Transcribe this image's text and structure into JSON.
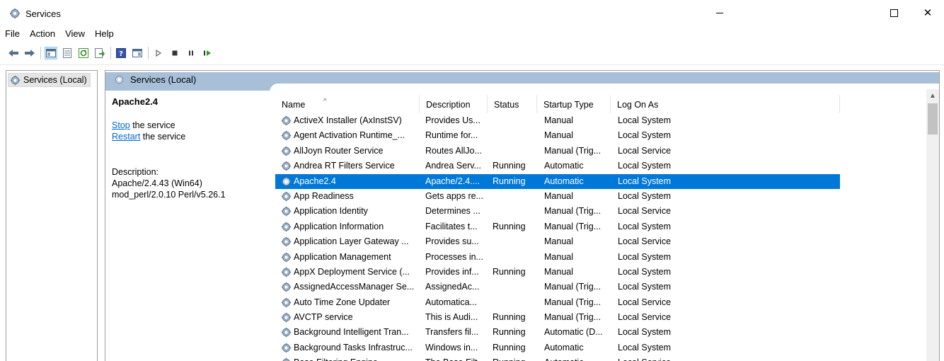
{
  "window": {
    "title": "Services",
    "icon": "services-gear-icon",
    "controls": [
      "minimize-icon",
      "maximize-icon",
      "close-icon"
    ],
    "close_glyph": "✕"
  },
  "menu": {
    "items": [
      "File",
      "Action",
      "View",
      "Help"
    ]
  },
  "toolbar": {
    "icons": [
      "back-arrow-icon",
      "forward-arrow-icon",
      "console-tree-icon",
      "properties-icon",
      "refresh-icon",
      "export-list-icon",
      "help-icon",
      "show-action-pane-icon",
      "start-service-icon",
      "stop-service-icon",
      "pause-service-icon",
      "restart-service-icon"
    ]
  },
  "tree": {
    "root_label": "Services (Local)"
  },
  "pane": {
    "title": "Services (Local)"
  },
  "details": {
    "service_name": "Apache2.4",
    "stop_link": "Stop",
    "stop_suffix": " the service",
    "restart_link": "Restart",
    "restart_suffix": " the service",
    "description_label": "Description:",
    "description_text": "Apache/2.4.43 (Win64) mod_perl/2.0.10 Perl/v5.26.1"
  },
  "list": {
    "sort_indicator": "^",
    "columns": [
      "Name",
      "Description",
      "Status",
      "Startup Type",
      "Log On As"
    ],
    "rows": [
      {
        "name": "ActiveX Installer (AxInstSV)",
        "description": "Provides Us...",
        "status": "",
        "startup": "Manual",
        "logon": "Local System"
      },
      {
        "name": "Agent Activation Runtime_...",
        "description": "Runtime for...",
        "status": "",
        "startup": "Manual",
        "logon": "Local System"
      },
      {
        "name": "AllJoyn Router Service",
        "description": "Routes AllJo...",
        "status": "",
        "startup": "Manual (Trig...",
        "logon": "Local Service"
      },
      {
        "name": "Andrea RT Filters Service",
        "description": "Andrea Serv...",
        "status": "Running",
        "startup": "Automatic",
        "logon": "Local System"
      },
      {
        "name": "Apache2.4",
        "description": "Apache/2.4....",
        "status": "Running",
        "startup": "Automatic",
        "logon": "Local System",
        "selected": true
      },
      {
        "name": "App Readiness",
        "description": "Gets apps re...",
        "status": "",
        "startup": "Manual",
        "logon": "Local System"
      },
      {
        "name": "Application Identity",
        "description": "Determines ...",
        "status": "",
        "startup": "Manual (Trig...",
        "logon": "Local Service"
      },
      {
        "name": "Application Information",
        "description": "Facilitates t...",
        "status": "Running",
        "startup": "Manual (Trig...",
        "logon": "Local System"
      },
      {
        "name": "Application Layer Gateway ...",
        "description": "Provides su...",
        "status": "",
        "startup": "Manual",
        "logon": "Local Service"
      },
      {
        "name": "Application Management",
        "description": "Processes in...",
        "status": "",
        "startup": "Manual",
        "logon": "Local System"
      },
      {
        "name": "AppX Deployment Service (...",
        "description": "Provides inf...",
        "status": "Running",
        "startup": "Manual",
        "logon": "Local System"
      },
      {
        "name": "AssignedAccessManager Se...",
        "description": "AssignedAc...",
        "status": "",
        "startup": "Manual (Trig...",
        "logon": "Local System"
      },
      {
        "name": "Auto Time Zone Updater",
        "description": "Automatica...",
        "status": "",
        "startup": "Manual (Trig...",
        "logon": "Local Service"
      },
      {
        "name": "AVCTP service",
        "description": "This is Audi...",
        "status": "Running",
        "startup": "Manual (Trig...",
        "logon": "Local Service"
      },
      {
        "name": "Background Intelligent Tran...",
        "description": "Transfers fil...",
        "status": "Running",
        "startup": "Automatic (D...",
        "logon": "Local System"
      },
      {
        "name": "Background Tasks Infrastruc...",
        "description": "Windows in...",
        "status": "Running",
        "startup": "Automatic",
        "logon": "Local System"
      },
      {
        "name": "Base Filtering Engine",
        "description": "The Base Filt...",
        "status": "Running",
        "startup": "Automatic",
        "logon": "Local Service"
      }
    ]
  },
  "colors": {
    "selection": "#0078d7",
    "header_band": "#a7bfd7",
    "link": "#0066cc"
  }
}
